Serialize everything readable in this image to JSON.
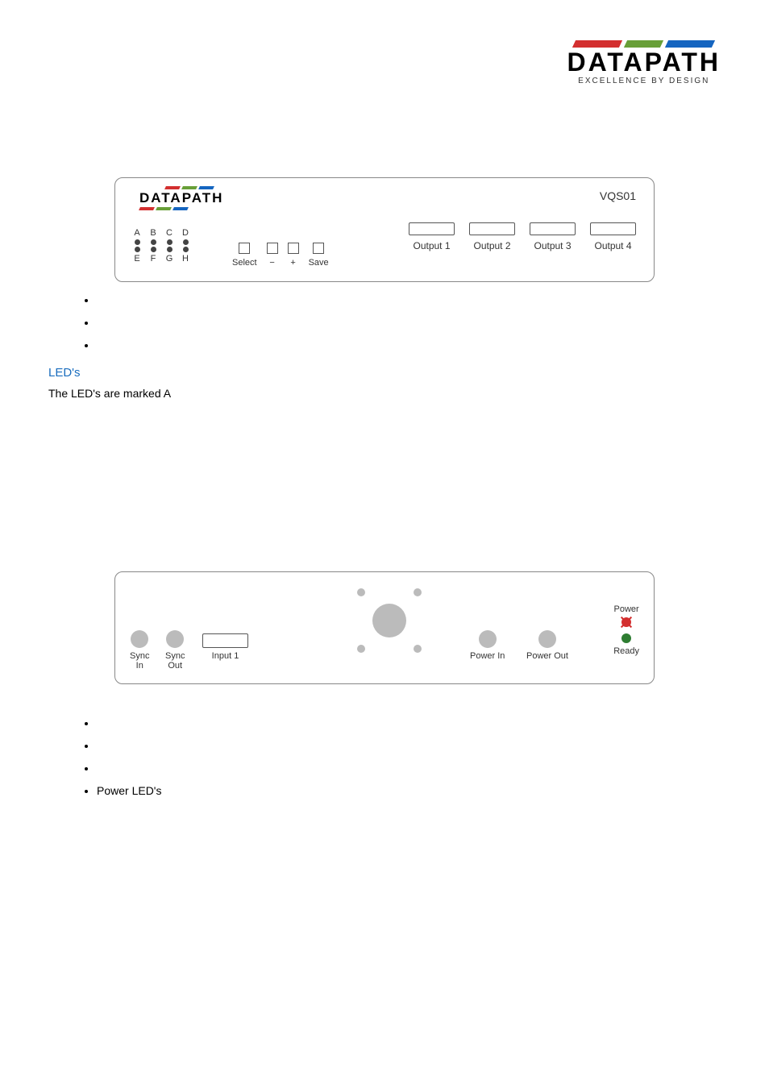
{
  "brand": {
    "name": "DATAPATH",
    "tagline": "EXCELLENCE BY DESIGN",
    "bar_colors": {
      "red": "#d32f2f",
      "green": "#689f38",
      "blue": "#1565c0"
    }
  },
  "front_panel": {
    "model": "VQS01",
    "led_labels_top": [
      "A",
      "B",
      "C",
      "D"
    ],
    "led_labels_bottom": [
      "E",
      "F",
      "G",
      "H"
    ],
    "buttons": [
      "Select",
      "−",
      "+",
      "Save"
    ],
    "outputs": [
      "Output 1",
      "Output 2",
      "Output 3",
      "Output 4"
    ]
  },
  "front_bullets": [
    "",
    "",
    ""
  ],
  "led_section": {
    "heading": "LED's",
    "text": "The LED's are marked A"
  },
  "rear_panel": {
    "sync_in": "Sync\nIn",
    "sync_out": "Sync\nOut",
    "input1": "Input 1",
    "power_in": "Power In",
    "power_out": "Power Out",
    "power": "Power",
    "ready": "Ready"
  },
  "rear_bullets": [
    "",
    "",
    "",
    "Power LED's"
  ]
}
